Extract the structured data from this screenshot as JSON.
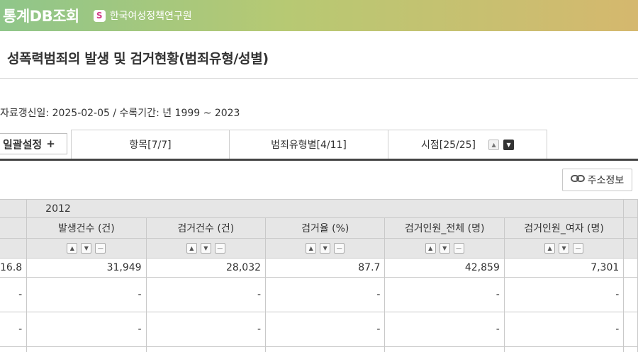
{
  "header": {
    "app_title": "통계DB조회",
    "org_logo": "S",
    "org_name": "한국여성정책연구원"
  },
  "page": {
    "title": "성폭력범죄의 발생 및 검거현황(범죄유형/성별)",
    "meta": "자료갱신일: 2025-02-05 / 수록기간: 년 1999 ~ 2023"
  },
  "tabs": {
    "setting_label": "일괄설정",
    "setting_plus": "+",
    "items": [
      "항목[7/7]",
      "범죄유형별[4/11]",
      "시점[25/25]"
    ],
    "sort_up": "▲",
    "sort_down": "▼"
  },
  "toolbar": {
    "address_label": "주소정보",
    "address_icon": "link-icon"
  },
  "table": {
    "year": "2012",
    "columns": [
      "발생건수 (건)",
      "검거건수 (건)",
      "검거율 (%)",
      "검거인원_전체 (명)",
      "검거인원_여자 (명)"
    ],
    "controls": [
      "▲",
      "▼",
      "—"
    ],
    "rows": [
      [
        "16.8",
        "31,949",
        "28,032",
        "87.7",
        "42,859",
        "7,301"
      ],
      [
        "-",
        "-",
        "-",
        "-",
        "-",
        "-"
      ],
      [
        "-",
        "-",
        "-",
        "-",
        "-",
        "-"
      ]
    ]
  }
}
